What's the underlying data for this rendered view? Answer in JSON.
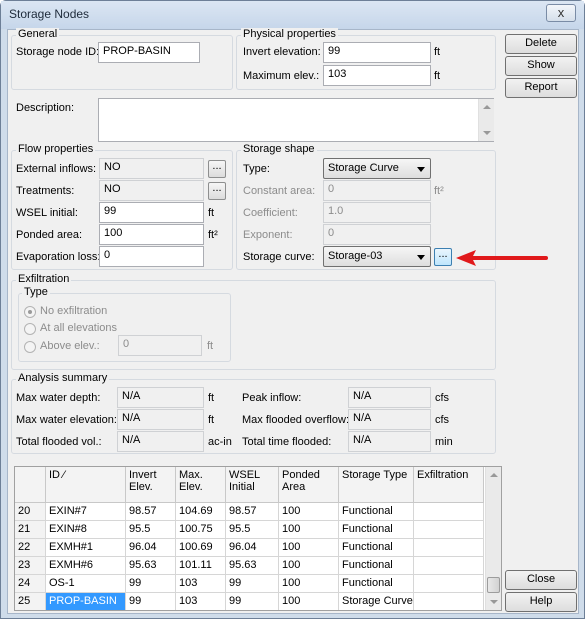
{
  "window": {
    "title": "Storage Nodes",
    "close_label": "x"
  },
  "general": {
    "group_title": "General",
    "id_label": "Storage node ID:",
    "id_value": "PROP-BASIN"
  },
  "physical": {
    "group_title": "Physical properties",
    "invert_label": "Invert elevation:",
    "invert_value": "99",
    "invert_unit": "ft",
    "max_label": "Maximum elev.:",
    "max_value": "103",
    "max_unit": "ft"
  },
  "description": {
    "label": "Description:",
    "value": ""
  },
  "flow": {
    "group_title": "Flow properties",
    "ext_label": "External inflows:",
    "ext_value": "NO",
    "treat_label": "Treatments:",
    "treat_value": "NO",
    "wsel_label": "WSEL initial:",
    "wsel_value": "99",
    "wsel_unit": "ft",
    "ponded_label": "Ponded area:",
    "ponded_value": "100",
    "ponded_unit": "ft²",
    "evap_label": "Evaporation loss:",
    "evap_value": "0",
    "browse_label": "..."
  },
  "shape": {
    "group_title": "Storage shape",
    "type_label": "Type:",
    "type_value": "Storage Curve",
    "const_label": "Constant area:",
    "const_value": "0",
    "const_unit": "ft²",
    "coef_label": "Coefficient:",
    "coef_value": "1.0",
    "exp_label": "Exponent:",
    "exp_value": "0",
    "curve_label": "Storage curve:",
    "curve_value": "Storage-03",
    "browse_label": "..."
  },
  "exfiltration": {
    "group_title": "Exfiltration",
    "type_title": "Type",
    "opt1": "No exfiltration",
    "opt2": "At all elevations",
    "opt3": "Above elev.:",
    "above_value": "0",
    "above_unit": "ft"
  },
  "analysis": {
    "group_title": "Analysis summary",
    "max_depth_label": "Max water depth:",
    "max_depth_value": "N/A",
    "max_depth_unit": "ft",
    "max_elev_label": "Max water elevation:",
    "max_elev_value": "N/A",
    "max_elev_unit": "ft",
    "total_flood_label": "Total flooded vol.:",
    "total_flood_value": "N/A",
    "total_flood_unit": "ac-in",
    "peak_label": "Peak inflow:",
    "peak_value": "N/A",
    "peak_unit": "cfs",
    "max_overflow_label": "Max flooded overflow:",
    "max_overflow_value": "N/A",
    "max_overflow_unit": "cfs",
    "total_time_label": "Total time flooded:",
    "total_time_value": "N/A",
    "total_time_unit": "min"
  },
  "buttons": {
    "delete": "Delete",
    "show": "Show",
    "report": "Report",
    "close": "Close",
    "help": "Help"
  },
  "table": {
    "headers": [
      "ID ⁄",
      "Invert Elev.",
      "Max. Elev.",
      "WSEL Initial",
      "Ponded Area",
      "Storage Type",
      "Exfiltration"
    ],
    "rows": [
      {
        "num": "20",
        "cells": [
          "EXIN#7",
          "98.57",
          "104.69",
          "98.57",
          "100",
          "Functional",
          ""
        ]
      },
      {
        "num": "21",
        "cells": [
          "EXIN#8",
          "95.5",
          "100.75",
          "95.5",
          "100",
          "Functional",
          ""
        ]
      },
      {
        "num": "22",
        "cells": [
          "EXMH#1",
          "96.04",
          "100.69",
          "96.04",
          "100",
          "Functional",
          ""
        ]
      },
      {
        "num": "23",
        "cells": [
          "EXMH#6",
          "95.63",
          "101.11",
          "95.63",
          "100",
          "Functional",
          ""
        ]
      },
      {
        "num": "24",
        "cells": [
          "OS-1",
          "99",
          "103",
          "99",
          "100",
          "Functional",
          ""
        ]
      },
      {
        "num": "25",
        "cells": [
          "PROP-BASIN",
          "99",
          "103",
          "99",
          "100",
          "Storage Curve",
          ""
        ]
      }
    ]
  },
  "colors": {
    "accent_arrow": "#e0191b",
    "selection": "#3399ff"
  }
}
